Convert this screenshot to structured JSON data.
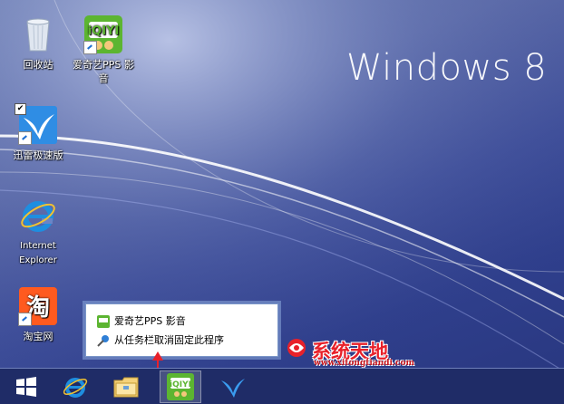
{
  "wallpaper": {
    "title": "Windows 8"
  },
  "desktop_icons": [
    {
      "label": "回收站",
      "icon": "recycle-bin-icon"
    },
    {
      "label": "爱奇艺PPS 影音",
      "icon": "iqiyi-icon"
    },
    {
      "label": "迅雷极速版",
      "icon": "xunlei-icon"
    },
    {
      "label": "Internet Explorer",
      "icon": "ie-icon"
    },
    {
      "label": "淘宝网",
      "icon": "taobao-icon"
    }
  ],
  "jump_list": {
    "app_item": "爱奇艺PPS 影音",
    "unpin_item": "从任务栏取消固定此程序"
  },
  "watermark": {
    "text": "系统天地",
    "url": "www.xitongtiandi.com"
  },
  "taskbar": {
    "items": [
      "start-icon",
      "ie-icon",
      "file-explorer-icon",
      "iqiyi-icon",
      "xunlei-icon"
    ],
    "active_item": "iqiyi-icon"
  },
  "colors": {
    "taskbar": "#1f2c67",
    "accent_red": "#e8212a",
    "iqiyi_green": "#5cb531",
    "ie_blue": "#1e8ee0"
  }
}
